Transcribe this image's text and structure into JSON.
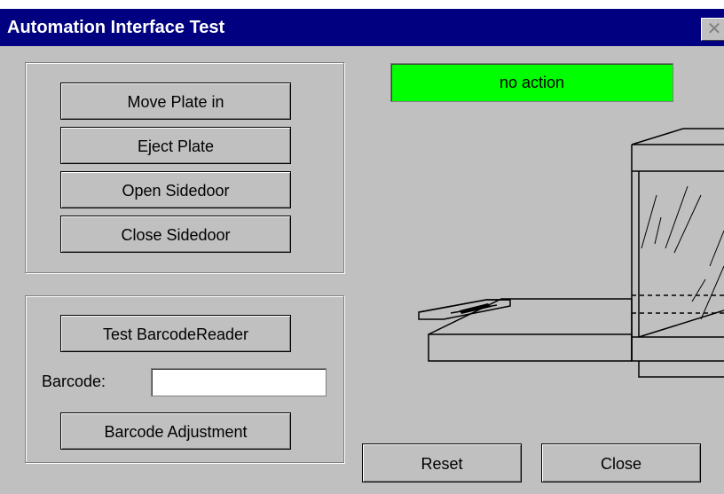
{
  "window": {
    "title": "Automation Interface  Test",
    "close_glyph": "✕"
  },
  "status": {
    "text": "no action",
    "color": "#00ff00"
  },
  "plate_group": {
    "move_in_label": "Move Plate in",
    "eject_label": "Eject Plate",
    "open_sidedoor_label": "Open Sidedoor",
    "close_sidedoor_label": "Close Sidedoor"
  },
  "barcode_group": {
    "test_reader_label": "Test BarcodeReader",
    "barcode_label": "Barcode:",
    "barcode_value": "",
    "adjustment_label": "Barcode Adjustment"
  },
  "footer": {
    "reset_label": "Reset",
    "close_label": "Close"
  },
  "colors": {
    "title_bar": "#000080",
    "face": "#c0c0c0"
  }
}
